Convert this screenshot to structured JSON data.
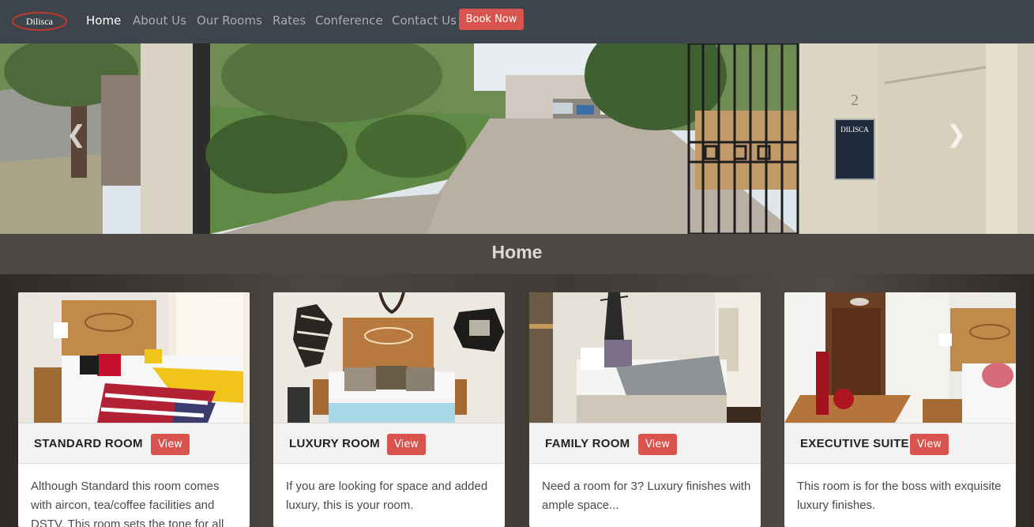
{
  "navbar": {
    "logo_text": "Dilisca",
    "links": [
      "Home",
      "About Us",
      "Our Rooms",
      "Rates",
      "Conference",
      "Contact Us"
    ],
    "book_label": "Book Now"
  },
  "hero": {
    "sign_text": "DILISCA",
    "house_number": "2",
    "prev_icon": "chevron-left-icon",
    "next_icon": "chevron-right-icon"
  },
  "banner": {
    "title": "Home"
  },
  "rooms": [
    {
      "title": "STANDARD ROOM",
      "view_label": "View",
      "text": "Although Standard this room comes with aircon, tea/coffee facilities and DSTV. This room sets the tone for all"
    },
    {
      "title": "LUXURY ROOM",
      "view_label": "View",
      "text": "If you are looking for space and added luxury, this is your room."
    },
    {
      "title": "FAMILY ROOM",
      "view_label": "View",
      "text": "Need a room for 3? Luxury finishes with ample space..."
    },
    {
      "title": "EXECUTIVE SUITE",
      "view_label": "View",
      "text": "This room is for the boss with exquisite luxury finishes."
    }
  ],
  "colors": {
    "navbar_bg": "#3e444c",
    "accent": "#d9534f",
    "nav_active": "#ffffff",
    "nav_inactive": "#a9adb1"
  }
}
